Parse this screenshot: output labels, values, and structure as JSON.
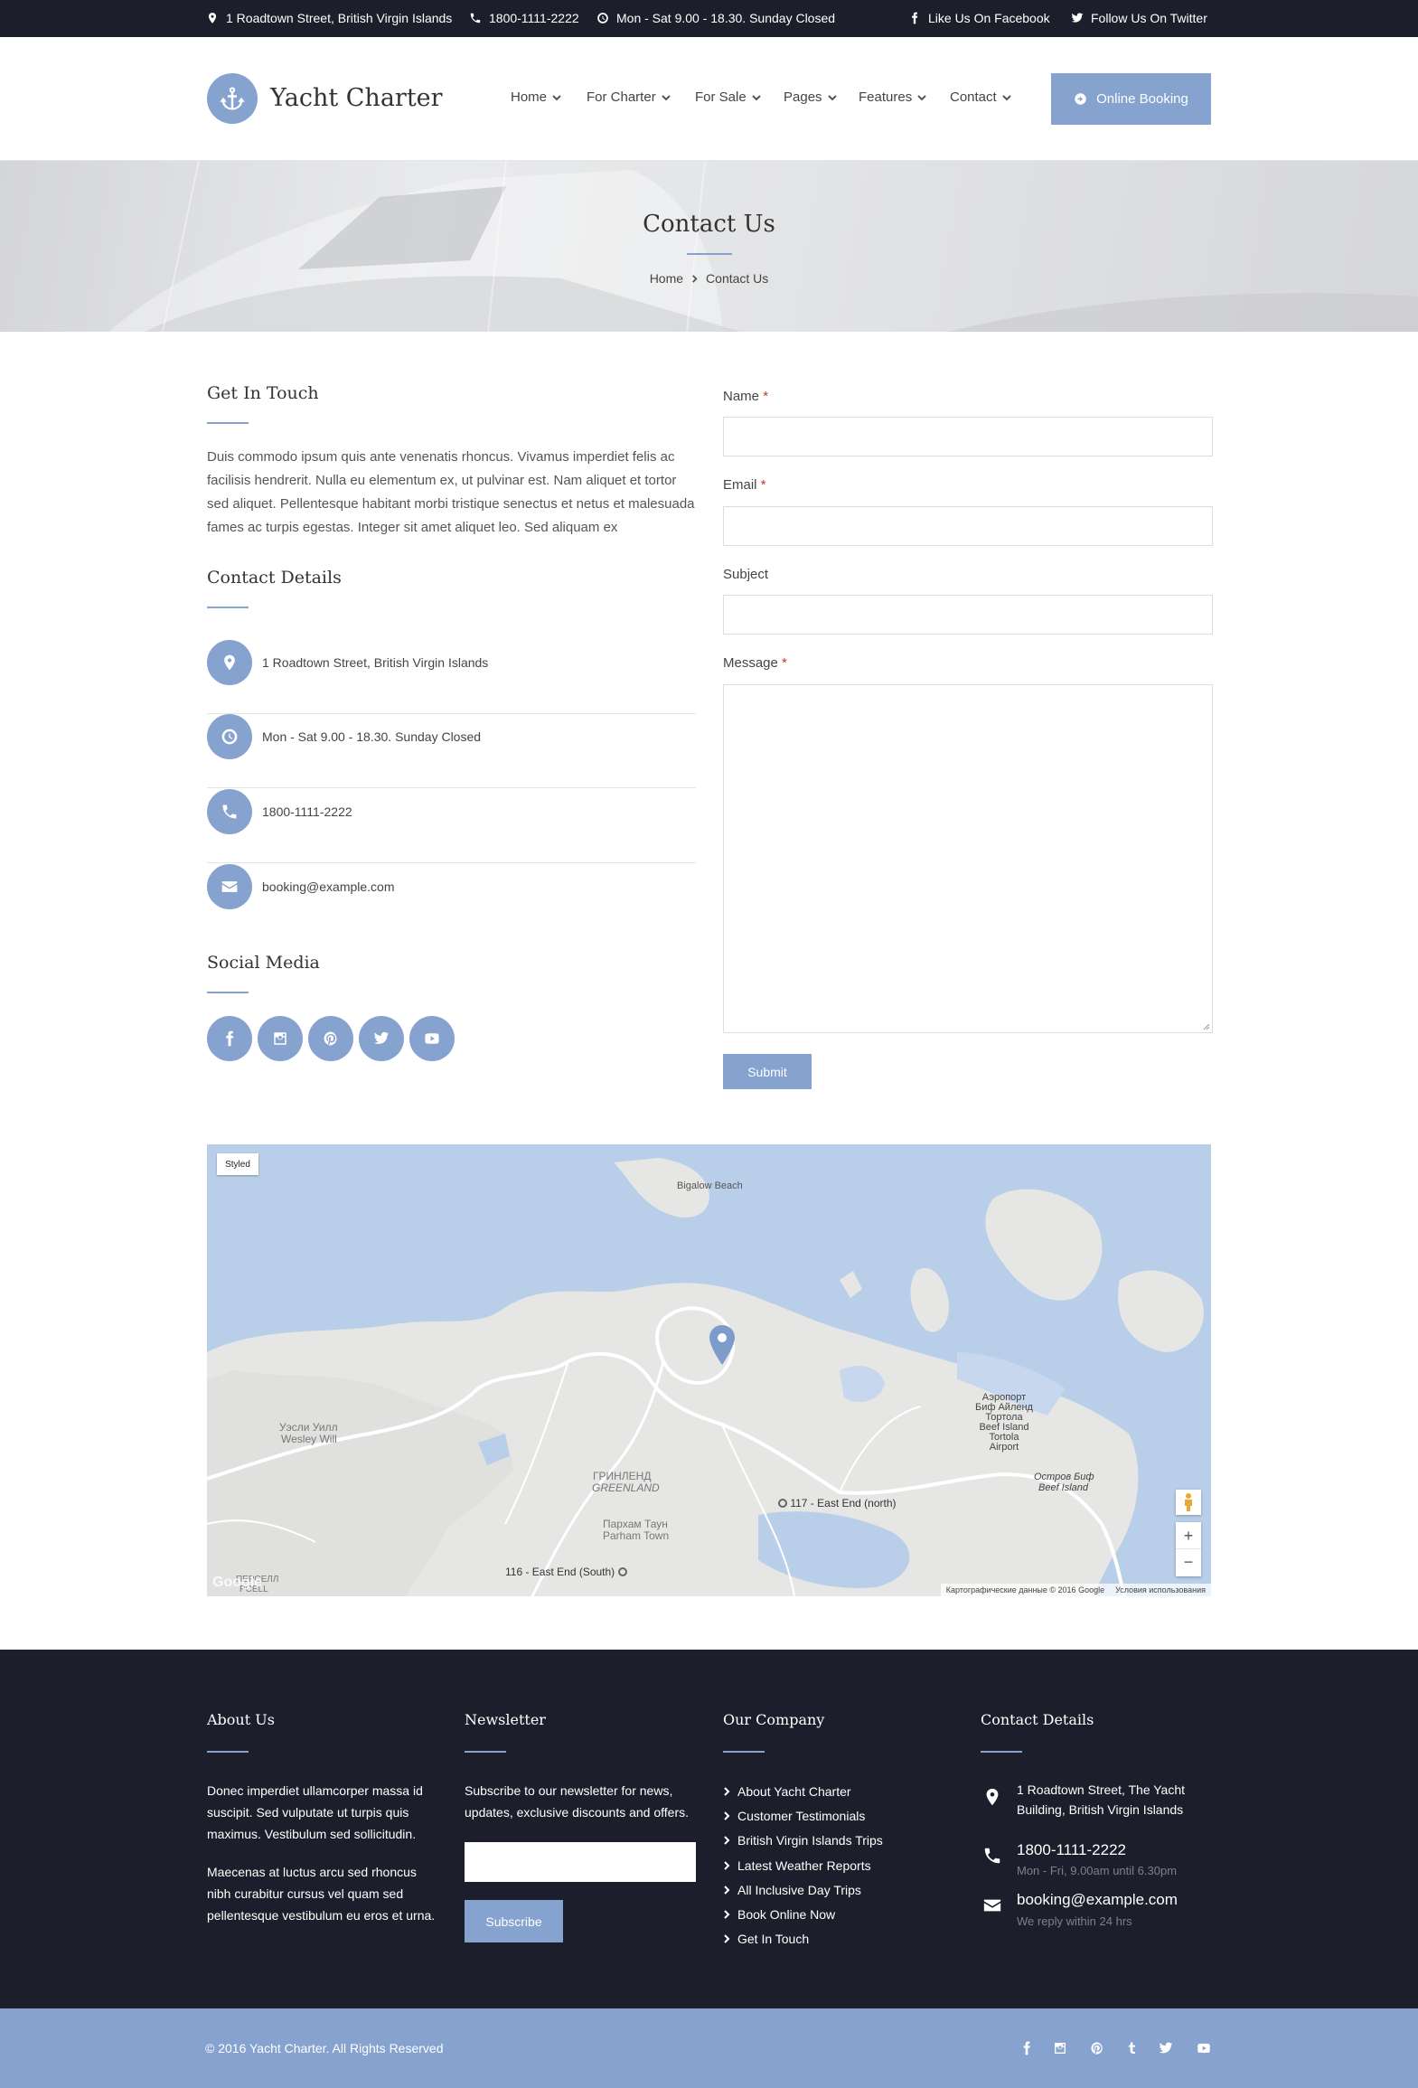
{
  "topbar": {
    "address": "1 Roadtown Street, British Virgin Islands",
    "phone": "1800-1111-2222",
    "hours": "Mon - Sat 9.00 - 18.30. Sunday Closed",
    "facebook": "Like Us On Facebook",
    "twitter": "Follow Us On Twitter"
  },
  "header": {
    "logo_text": "Yacht Charter",
    "nav": [
      "Home",
      "For Charter",
      "For Sale",
      "Pages",
      "Features",
      "Contact"
    ],
    "booking_label": "Online Booking"
  },
  "banner": {
    "title": "Contact Us",
    "breadcrumb_home": "Home",
    "breadcrumb_current": "Contact Us"
  },
  "get_in_touch": {
    "heading": "Get In Touch",
    "text": "Duis commodo ipsum quis ante venenatis rhoncus. Vivamus imperdiet felis ac facilisis hendrerit. Nulla eu elementum ex, ut pulvinar est. Nam aliquet et tortor sed aliquet. Pellentesque habitant morbi tristique senectus et netus et malesuada fames ac turpis egestas. Integer sit amet aliquet leo. Sed aliquam ex"
  },
  "contact_details": {
    "heading": "Contact Details",
    "items": [
      {
        "icon": "map-marker-icon",
        "text": "1 Roadtown Street, British Virgin Islands"
      },
      {
        "icon": "clock-icon",
        "text": "Mon - Sat 9.00 - 18.30. Sunday Closed"
      },
      {
        "icon": "phone-icon",
        "text": "1800-1111-2222"
      },
      {
        "icon": "envelope-icon",
        "text": "booking@example.com"
      }
    ]
  },
  "social_media": {
    "heading": "Social Media",
    "icons": [
      "facebook-icon",
      "instagram-icon",
      "pinterest-icon",
      "twitter-icon",
      "youtube-icon"
    ]
  },
  "form": {
    "name_label": "Name",
    "email_label": "Email",
    "subject_label": "Subject",
    "message_label": "Message",
    "required_mark": "*",
    "submit_label": "Submit"
  },
  "map": {
    "styled_label": "Styled",
    "labels": {
      "bigalow": "Bigalow Beach",
      "wesley_ru": "Уэсли Уилл",
      "wesley": "Wesley Will",
      "greenland_ru": "ГРИНЛЕНД",
      "greenland": "GREENLAND",
      "parham_ru": "Пархам Таун",
      "parham": "Parham Town",
      "road117": "117 - East End (north)",
      "road116": "116 - East End (South)",
      "airport_ru1": "Аэропорт",
      "airport_ru2": "Биф Айленд",
      "airport_ru3": "Тортола",
      "airport_en1": "Beef Island",
      "airport_en2": "Tortola",
      "airport_en3": "Airport",
      "beef_ru": "Остров Биф",
      "beef": "Beef Island",
      "pcell_ru": "ПЕРСЕЛЛ",
      "pcell": "PCELL",
      "google": "Google",
      "attribution": "Картографические данные © 2016 Google",
      "terms": "Условия использования"
    },
    "zoom_in": "+",
    "zoom_out": "−"
  },
  "footer": {
    "about": {
      "heading": "About Us",
      "p1": "Donec imperdiet ullamcorper massa id suscipit. Sed vulputate ut turpis quis maximus. Vestibulum sed sollicitudin.",
      "p2": "Maecenas at luctus arcu sed rhoncus nibh curabitur cursus vel quam sed pellentesque vestibulum eu eros et urna."
    },
    "newsletter": {
      "heading": "Newsletter",
      "text": "Subscribe to our newsletter for news, updates, exclusive discounts and offers.",
      "button": "Subscribe"
    },
    "company": {
      "heading": "Our Company",
      "links": [
        "About Yacht Charter",
        "Customer Testimonials",
        "British Virgin Islands Trips",
        "Latest Weather Reports",
        "All Inclusive Day Trips",
        "Book Online Now",
        "Get In Touch"
      ]
    },
    "contact": {
      "heading": "Contact Details",
      "address_line1": "1 Roadtown Street, The Yacht",
      "address_line2": "Building, British Virgin Islands",
      "phone": "1800-1111-2222",
      "phone_sub": "Mon - Fri, 9.00am until 6.30pm",
      "email": "booking@example.com",
      "email_sub": "We reply within 24 hrs"
    }
  },
  "bottombar": {
    "copyright": "© 2016 Yacht Charter. All Rights Reserved",
    "icons": [
      "facebook-icon",
      "instagram-icon",
      "pinterest-icon",
      "tumblr-icon",
      "twitter-icon",
      "youtube-icon"
    ]
  },
  "colors": {
    "accent": "#86a2cf",
    "dark": "#1c1f2b"
  }
}
